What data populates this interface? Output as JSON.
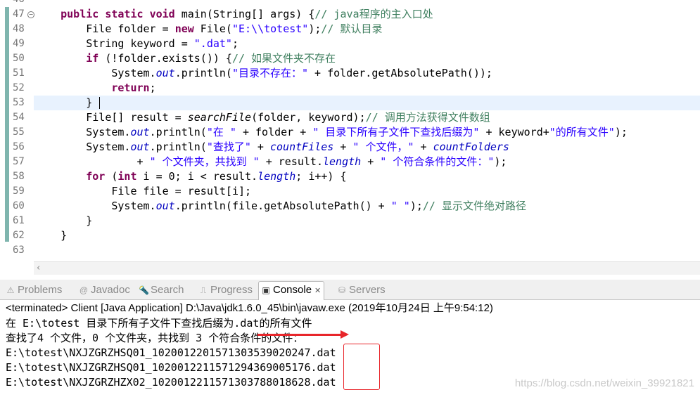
{
  "editor": {
    "lines": [
      {
        "num": "46",
        "html": ""
      },
      {
        "num": "47",
        "fold": "⊖",
        "html": "    <span class='kw'>public</span> <span class='kw'>static</span> <span class='kw'>void</span> main(String[] args) {<span class='cm'>// java程序的主入口处</span>"
      },
      {
        "num": "48",
        "html": "        File folder = <span class='kw'>new</span> File(<span class='str'>\"E:\\\\totest\"</span>);<span class='cm'>// 默认目录</span>"
      },
      {
        "num": "49",
        "html": "        String keyword = <span class='str'>\".dat\"</span>;"
      },
      {
        "num": "50",
        "html": "        <span class='kw'>if</span> (!folder.exists()) {<span class='cm'>// 如果文件夹不存在</span>"
      },
      {
        "num": "51",
        "html": "            System.<span class='fld'>out</span>.println(<span class='str'>\"目录不存在：\"</span> + folder.getAbsolutePath());"
      },
      {
        "num": "52",
        "html": "            <span class='kw'>return</span>;"
      },
      {
        "num": "53",
        "current": true,
        "html": "        }"
      },
      {
        "num": "54",
        "html": "        File[] result = <span class='mth'>searchFile</span>(folder, keyword);<span class='cm'>// 调用方法获得文件数组</span>"
      },
      {
        "num": "55",
        "html": "        System.<span class='fld'>out</span>.println(<span class='str'>\"在 \"</span> + folder + <span class='str'>\" 目录下所有子文件下查找后缀为\"</span> + keyword+<span class='str'>\"的所有文件\"</span>);"
      },
      {
        "num": "56",
        "html": "        System.<span class='fld'>out</span>.println(<span class='str'>\"查找了\"</span> + <span class='fld'>countFiles</span> + <span class='str'>\" 个文件，\"</span> + <span class='fld'>countFolders</span>"
      },
      {
        "num": "57",
        "html": "                + <span class='str'>\" 个文件夹，共找到 \"</span> + result.<span class='fld'>length</span> + <span class='str'>\" 个符合条件的文件：\"</span>);"
      },
      {
        "num": "58",
        "html": "        <span class='kw'>for</span> (<span class='kw'>int</span> i = 0; i &lt; result.<span class='fld'>length</span>; i++) {"
      },
      {
        "num": "59",
        "html": "            File file = result[i];"
      },
      {
        "num": "60",
        "html": "            System.<span class='fld'>out</span>.println(file.getAbsolutePath() + <span class='str'>\" \"</span>);<span class='cm'>// 显示文件绝对路径</span>"
      },
      {
        "num": "61",
        "html": "        }"
      },
      {
        "num": "62",
        "html": "    }"
      },
      {
        "num": "63",
        "html": ""
      }
    ]
  },
  "tabs": [
    {
      "name": "tab-problems",
      "icon": "problems-icon",
      "glyph": "⚠",
      "label": "Problems"
    },
    {
      "name": "tab-javadoc",
      "icon": "javadoc-icon",
      "glyph": "@",
      "label": "Javadoc"
    },
    {
      "name": "tab-search",
      "icon": "search-icon",
      "glyph": "🔦",
      "label": "Search"
    },
    {
      "name": "tab-progress",
      "icon": "progress-icon",
      "glyph": "⎍",
      "label": "Progress"
    },
    {
      "name": "tab-console",
      "icon": "console-icon",
      "glyph": "▣",
      "label": "Console",
      "active": true,
      "close": "✕"
    },
    {
      "name": "tab-servers",
      "icon": "servers-icon",
      "glyph": "⛁",
      "label": "Servers"
    }
  ],
  "console": {
    "terminated": "<terminated> Client [Java Application] D:\\Java\\jdk1.6.0_45\\bin\\javaw.exe (2019年10月24日 上午9:54:12)",
    "output": [
      "在 E:\\totest 目录下所有子文件下查找后缀为.dat的所有文件",
      "查找了4 个文件，0 个文件夹，共找到 3 个符合条件的文件：",
      "E:\\totest\\NXJZGRZHSQ01_10200122015713035390 20247.dat",
      "E:\\totest\\NXJZGRZHSQ01_10200122115712943690 05176.dat",
      "E:\\totest\\NXJZGRZHZX02_10200122115713037880 18628.dat"
    ],
    "watermark": "https://blog.csdn.net/weixin_39921821"
  },
  "colors": {
    "keyword": "#7f0055",
    "string": "#2a00ff",
    "comment": "#3f7f5f",
    "annotation_red": "#e8262b"
  }
}
